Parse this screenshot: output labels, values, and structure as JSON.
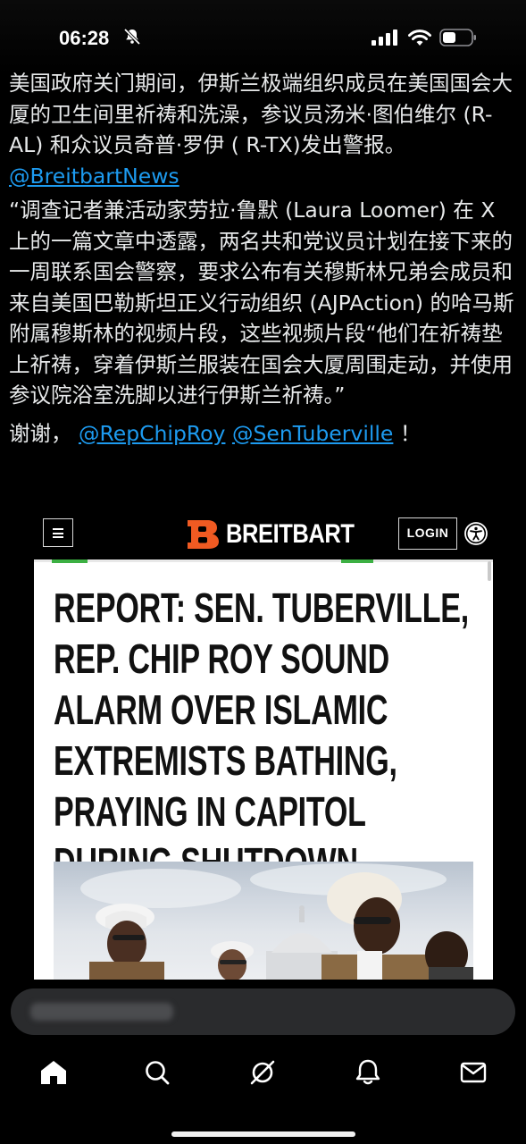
{
  "status_bar": {
    "time": "06:28",
    "icons": [
      "bell-slash-icon",
      "cellular-signal-icon",
      "wifi-icon",
      "battery-icon"
    ]
  },
  "post": {
    "para1": "美国政府关门期间，伊斯兰极端组织成员在美国国会大厦的卫生间里祈祷和洗澡，参议员汤米·图伯维尔 (R-AL) 和众议员奇普·罗伊 ( R-TX)发出警报。",
    "source_link": "@BreitbartNews",
    "para2": "“调查记者兼活动家劳拉·鲁默 (Laura Loomer) 在 X 上的一篇文章中透露，两名共和党议员计划在接下来的一周联系国会警察，要求公布有关穆斯林兄弟会成员和来自美国巴勒斯坦正义行动组织 (AJPAction) 的哈马斯附属穆斯林的视频片段，这些视频片段“他们在祈祷垫上祈祷，穿着伊斯兰服装在国会大厦周围走动，并使用参议院浴室洗脚以进行伊斯兰祈祷。”",
    "thanks_prefix": "谢谢，",
    "mention1": "@RepChipRoy",
    "mention2": "@SenTuberville",
    "thanks_suffix": "！"
  },
  "embed": {
    "site_name": "BREITBART",
    "login_label": "LOGIN",
    "headline_lines": [
      "REPORT: SEN. TUBERVILLE,",
      "REP. CHIP ROY SOUND",
      "ALARM OVER ISLAMIC",
      "EXTREMISTS BATHING,",
      "PRAYING IN CAPITOL",
      "DURING SHUTDOWN"
    ],
    "brand_color": "#f05a22",
    "accent_green": "#3cb043"
  },
  "bottom": {
    "tabs": [
      "home-icon",
      "search-icon",
      "grok-icon",
      "notifications-icon",
      "messages-icon"
    ]
  },
  "colors": {
    "background": "#000000",
    "text": "#e7e9ea",
    "link": "#1d9bf0"
  }
}
